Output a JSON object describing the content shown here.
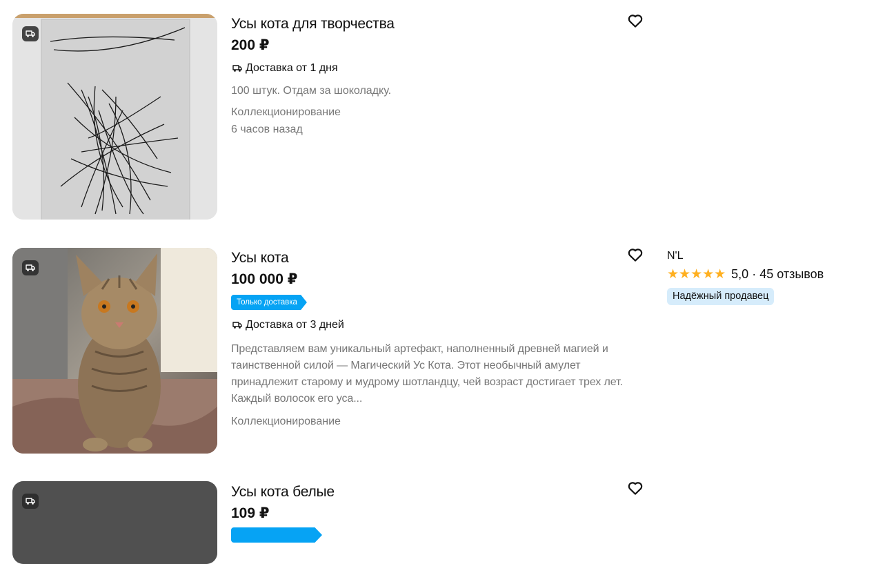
{
  "listings": [
    {
      "title": "Усы кота для творчества",
      "price": "200 ₽",
      "delivery": "Доставка от 1 дня",
      "description": "100 штук. Отдам за шоколадку.",
      "category": "Коллекционирование",
      "time": "6 часов назад"
    },
    {
      "title": "Усы кота",
      "price": "100 000 ₽",
      "badge": "Только доставка",
      "delivery": "Доставка от 3 дней",
      "description": "Представляем вам уникальный артефакт, наполненный древней магией и таинственной силой — Магический Ус Кота. Этот необычный амулет принадлежит старому и мудрому шотландцу, чей возраст достигает трех лет. Каждый волосок его уса...",
      "category": "Коллекционирование",
      "seller": {
        "name": "N'L",
        "rating": "5,0 · 45 отзывов",
        "badge": "Надёжный продавец"
      }
    },
    {
      "title": "Усы кота белые",
      "price": "109 ₽"
    }
  ],
  "icons": {
    "favorite": "heart-outline-icon",
    "delivery": "truck-icon",
    "star": "star-icon"
  },
  "colors": {
    "accent_blue": "#06a3f4",
    "star": "#ffb021",
    "trusted_bg": "#d6ecfb",
    "muted_text": "#777777"
  }
}
